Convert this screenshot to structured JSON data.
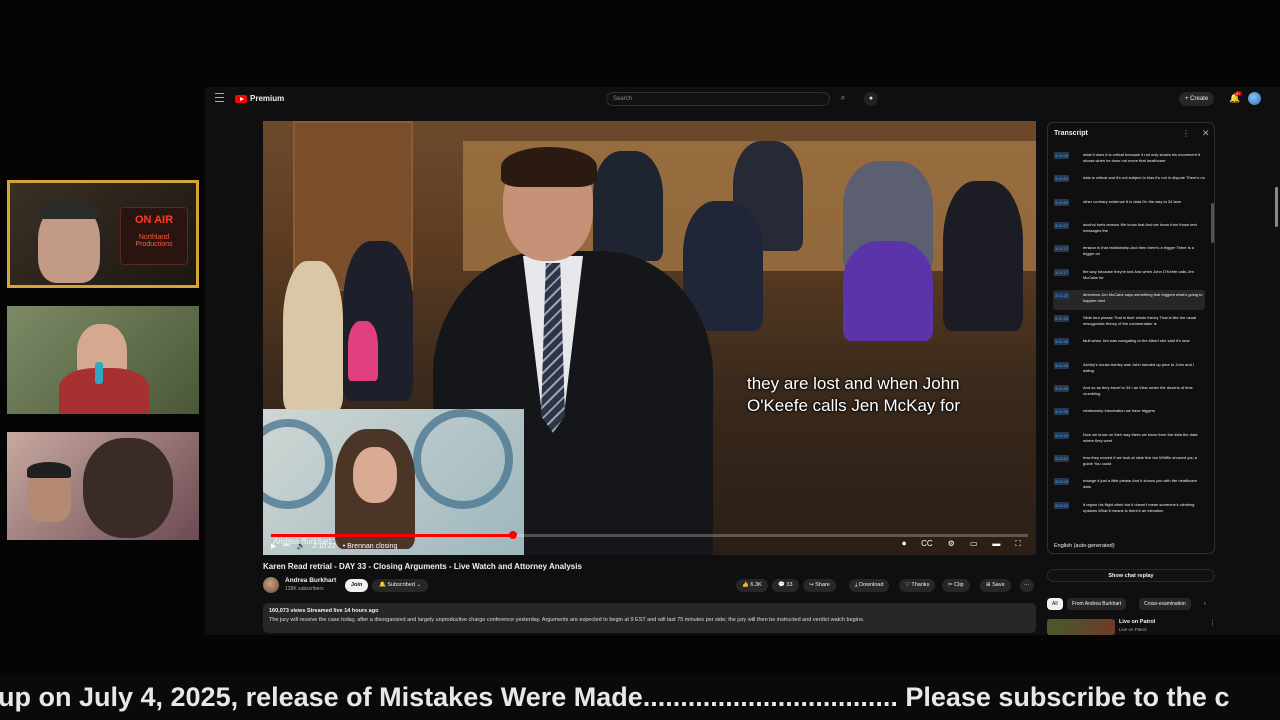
{
  "youtube": {
    "brand": "Premium",
    "search": {
      "placeholder": "Search"
    },
    "create_label": "Create",
    "notification_count": "9+"
  },
  "onair_sign": {
    "line1": "ON AIR",
    "line2": "Northland Productions"
  },
  "video": {
    "caption_line1": "they are lost and when John",
    "caption_line2": "O'Keefe calls Jen McKay for",
    "pip_name": "Andrea Burkhart",
    "time": "2:10:22",
    "chapter": "• Brennan closing",
    "progress_fraction": 0.32
  },
  "title": "Karen Read retrial - DAY 33 - Closing Arguments - Live Watch and Attorney Analysis",
  "channel": {
    "name": "Andrea Burkhart",
    "subscribers": "128K subscribers"
  },
  "buttons": {
    "join": "Join",
    "subscribed": "Subscribed",
    "likes": "6.3K",
    "comments": "33",
    "share": "Share",
    "download": "Download",
    "thanks": "Thanks",
    "clip": "Clip",
    "save": "Save"
  },
  "description": {
    "meta": "160,073 views  Streamed live 14 hours ago",
    "text": "The jury will receive the case today, after a disorganized and largely unproductive charge conference yesterday. Arguments are expected to begin at 9 EST and will last 75 minutes per side; the jury will then be instructed and verdict watch begins."
  },
  "transcript": {
    "title": "Transcript",
    "language": "English (auto-generated)",
    "lines": [
      {
        "time": "3:10:45",
        "text": "what it does it is critical because it not only shows his movement it shows when he does not move that healthcare"
      },
      {
        "time": "3:10:53",
        "text": "data is critical and it's not subject to bias it's not in dispute There's no"
      },
      {
        "time": "3:10:59",
        "text": "other contrary evidence It is data On the way to 34 lane"
      },
      {
        "time": "3:11:07",
        "text": "alcohol fuels tension We know that And we know from those text messages the"
      },
      {
        "time": "3:11:12",
        "text": "tension in that relationship And then there's a trigger There is a trigger on"
      },
      {
        "time": "3:11:17",
        "text": "the way because they're lost And when John O'Keefe calls Jen McCabe for"
      },
      {
        "time": "3:11:23",
        "text": "directions Jen McCabe says something that triggers what's going to happen next"
      },
      {
        "time": "3:11:29",
        "text": "Slide four please That is their whole theory That is like the usual misogynistic theory of the commentator is"
      },
      {
        "time": "3:11:36",
        "text": "fault when Jen was navigating to the Albert she said it's near"
      },
      {
        "time": "3:11:43",
        "text": "Ashley's house Ashley was John handed up prior to John and I dating"
      },
      {
        "time": "3:11:50",
        "text": "And so as they travel to 34 I as View under the dozens of time crumbling"
      },
      {
        "time": "3:11:55",
        "text": "relationship intoxication we have triggers"
      },
      {
        "time": "3:12:02",
        "text": "Now we know on their way there we know from the data the data where they went"
      },
      {
        "time": "3:12:07",
        "text": "how they moved If we look at slide five Ian Whiffin showed you a guide You could"
      },
      {
        "time": "3:12:16",
        "text": "enlarge it just a little please And it shows you with the healthcare data"
      },
      {
        "time": "3:12:22",
        "text": "it region his flight climb but it doesn't mean someone's climbing upstairs What it means is there's an elevation"
      }
    ]
  },
  "sidebar": {
    "show_chat_replay": "Show chat replay",
    "chips": [
      "All",
      "From Andrea Burkhart",
      "Cross-examination"
    ],
    "next_title": "Live on Patrol",
    "next_sub": "Live on Patrol"
  },
  "ticker": "up on July 4, 2025, release of Mistakes Were Made.................................. Please subscribe to the c"
}
